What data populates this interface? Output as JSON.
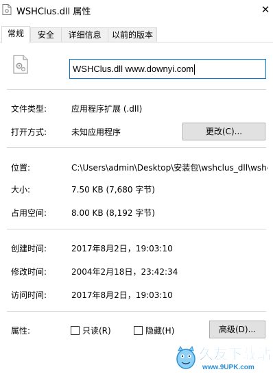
{
  "window": {
    "title": "WSHClus.dll 属性",
    "close_glyph": "✕"
  },
  "tabs": [
    {
      "label": "常规",
      "active": true
    },
    {
      "label": "安全",
      "active": false
    },
    {
      "label": "详细信息",
      "active": false
    },
    {
      "label": "以前的版本",
      "active": false
    }
  ],
  "file": {
    "icon": "dll-file-icon",
    "name_value": "WSHClus.dll www.downyi.com"
  },
  "general": {
    "type_label": "文件类型:",
    "type_value": "应用程序扩展 (.dll)",
    "opens_with_label": "打开方式:",
    "opens_with_value": "未知应用程序",
    "change_button": "更改(C)...",
    "location_label": "位置:",
    "location_value": "C:\\Users\\admin\\Desktop\\安装包\\wshclus_dll\\wshc",
    "size_label": "大小:",
    "size_value": "7.50 KB (7,680 字节)",
    "disk_size_label": "占用空间:",
    "disk_size_value": "8.00 KB (8,192 字节)",
    "created_label": "创建时间:",
    "created_value": "2017年8月2日，19:03:10",
    "modified_label": "修改时间:",
    "modified_value": "2004年2月18日，23:42:34",
    "accessed_label": "访问时间:",
    "accessed_value": "2017年8月2日，19:03:10",
    "attributes_label": "属性:",
    "readonly_label": "只读(R)",
    "readonly_checked": false,
    "hidden_label": "隐藏(H)",
    "hidden_checked": false,
    "advanced_button": "高级(D)..."
  },
  "watermark": {
    "text": "久友下载站",
    "url": "www.9UPK.com"
  },
  "colors": {
    "accent": "#0078d7",
    "button_bg": "#e1e1e1",
    "separator": "#d7d7d7",
    "watermark_blue": "#2c8fd6"
  }
}
